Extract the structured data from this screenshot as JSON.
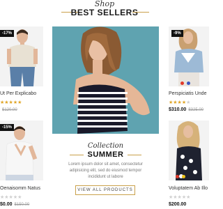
{
  "header": {
    "script_title": "Shop",
    "title": "BEST SELLERS"
  },
  "products": [
    {
      "badge": "-17%",
      "name": "Ut Per Explicabo",
      "rating": 5,
      "price": "",
      "old_price": "$120.00"
    },
    {
      "badge": "-15%",
      "name": "Oenaisomm Natus",
      "rating": 0,
      "price": "$0.00",
      "old_price": "$150.00"
    },
    {
      "badge": "-9%",
      "name": "Perspiciatis Unde",
      "rating": 4,
      "price": "$310.00",
      "old_price": "$325.00"
    },
    {
      "badge": "",
      "name": "Voluptatem Ab Illo",
      "rating": 0,
      "price": "$200.00",
      "old_price": ""
    }
  ],
  "collection": {
    "script_title": "Collection",
    "title": "SUMMER",
    "text": "Lorem ipsum dolor sit amet, consectetur adipisicing elit, sed do eiusmod tempor incididunt ut labore",
    "button_label": "VIEW ALL PRODUCTS"
  },
  "colors": {
    "accent": "#c9a04a",
    "star": "#e0a526",
    "badge_bg": "#111111",
    "hero_bg": "#5fa3b0"
  },
  "swatches": [
    "#e23a2a",
    "#3a58c4",
    "#f0c419"
  ]
}
